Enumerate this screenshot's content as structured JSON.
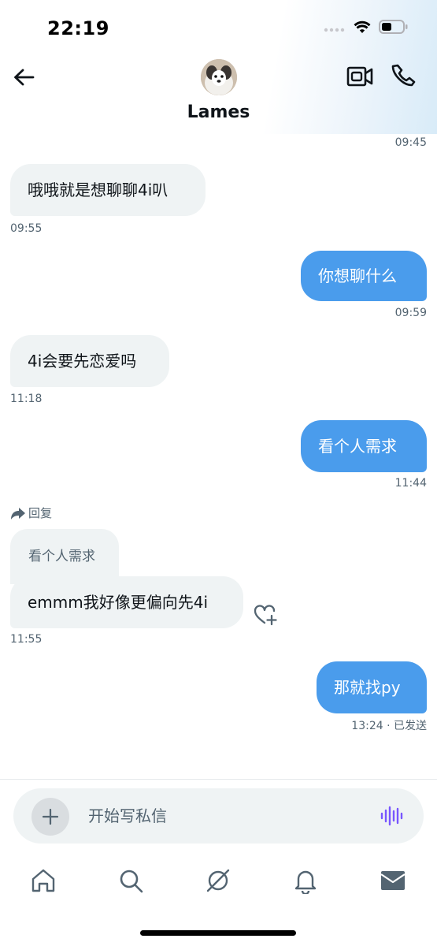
{
  "status_bar": {
    "time": "22:19"
  },
  "header": {
    "contact_name": "Lames"
  },
  "messages": [
    {
      "dir": "in",
      "text": "哦哦就是想聊聊4i叭",
      "time": "09:55"
    },
    {
      "dir": "out",
      "text": "你想聊什么",
      "time": "09:59"
    },
    {
      "dir": "in",
      "text": "4i会要先恋爱吗",
      "time": "11:18"
    },
    {
      "dir": "out",
      "text": "看个人需求",
      "time": "11:44"
    },
    {
      "dir": "in",
      "reply_label": "回复",
      "quoted_text": "看个人需求",
      "text": "emmm我好像更偏向先4i",
      "time": "11:55"
    },
    {
      "dir": "out",
      "text": "那就找py",
      "time": "13:24 · 已发送"
    }
  ],
  "top_time": "09:45",
  "composer": {
    "placeholder": "开始写私信"
  },
  "colors": {
    "accent": "#4a9cec",
    "incoming_bubble": "#eff3f4",
    "voice_icon": "#7856ff"
  },
  "tabs": [
    "home-icon",
    "search-icon",
    "grok-icon",
    "notifications-icon",
    "messages-icon"
  ]
}
